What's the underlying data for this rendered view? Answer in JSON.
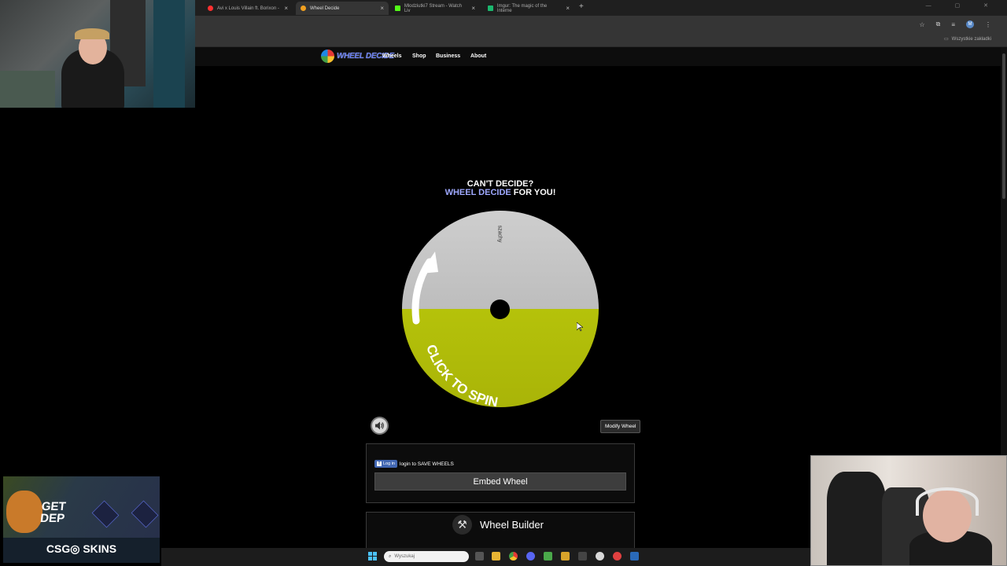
{
  "browser": {
    "tabs": [
      {
        "title": "Avi x Louis Villain ft. Borixon - ",
        "favicon_color": "#ff3030"
      },
      {
        "title": "Wheel Decide",
        "favicon_color": "#f0a020"
      },
      {
        "title": "Mlodziutki7 Stream - Watch Liv",
        "favicon_color": "#53fc18"
      },
      {
        "title": "Imgur: The magic of the Interne",
        "favicon_color": "#1bb76e"
      }
    ],
    "new_tab": "+",
    "profile_initial": "M",
    "bookmarks_all": "Wszystkie zakładki"
  },
  "site": {
    "logo_text": "WHEEL DECIDE",
    "nav": [
      "Wheels",
      "Shop",
      "Business",
      "About"
    ],
    "headline_line1": "CAN'T DECIDE?",
    "headline_blue": "WHEEL DECIDE",
    "headline_rest": " FOR YOU!",
    "wheel": {
      "segments": [
        {
          "label": "szachy",
          "color": "#c8c8c8"
        },
        {
          "label": "",
          "color": "#b0bd08"
        }
      ],
      "spin_text": "CLICK TO SPIN"
    },
    "sound_icon": "speaker-icon",
    "modify_button": "Modify Wheel",
    "fb_login_button": "Log in",
    "fb_login_text": "login to SAVE WHEELS",
    "embed_button": "Embed Wheel",
    "builder_title": "Wheel Builder"
  },
  "ad": {
    "headline": "GET\nDEP",
    "brand": "CSG◎ SKINS"
  },
  "taskbar": {
    "search_placeholder": "Wyszukaj"
  }
}
